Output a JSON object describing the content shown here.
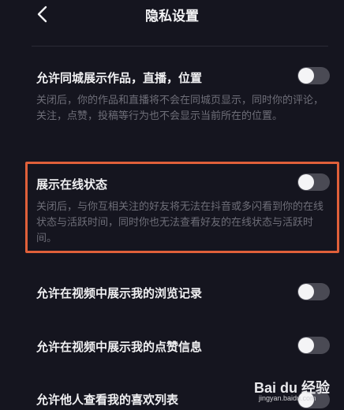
{
  "nav": {
    "title": "隐私设置"
  },
  "settings": [
    {
      "title": "允许同城展示作品，直播，位置",
      "description": "关闭后，你的作品和直播将不会在同城页显示，同时你的评论，关注，点赞，投稿等行为也不会显示当前所在的位置。",
      "enabled": false
    },
    {
      "title": "展示在线状态",
      "description": "关闭后，与你互相关注的好友将无法在抖音或多闪看到你的在线状态与活跃时间，同时你也无法查看好友的在线状态与活跃时间。",
      "enabled": false
    },
    {
      "title": "允许在视频中展示我的浏览记录",
      "enabled": false
    },
    {
      "title": "允许在视频中展示我的点赞信息",
      "enabled": false
    },
    {
      "title": "允许他人查看我的喜欢列表",
      "enabled": false
    }
  ],
  "colors": {
    "background": "#15151f",
    "highlight": "#e0603a",
    "toggle_off": "#4a4a54"
  },
  "watermark": {
    "brand": "Bai du 经验",
    "url": "jingyan.baidu.com"
  }
}
